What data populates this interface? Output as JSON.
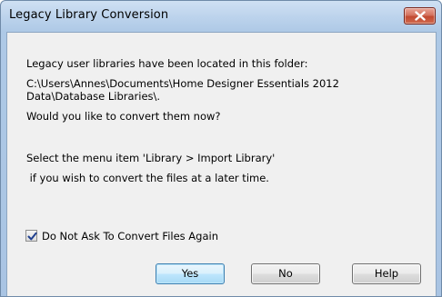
{
  "window": {
    "title": "Legacy Library Conversion"
  },
  "message": {
    "line1": "Legacy user libraries have been located in this folder:",
    "path_line1": "C:\\Users\\Annes\\Documents\\Home Designer Essentials 2012",
    "path_line2": "Data\\Database Libraries\\.",
    "question": "Would you like to convert them now?",
    "hint_line1": "Select the menu item 'Library > Import Library'",
    "hint_line2": " if you wish to convert the files at a later time."
  },
  "checkbox": {
    "label": "Do Not Ask To Convert Files Again",
    "checked": true
  },
  "buttons": {
    "yes": "Yes",
    "no": "No",
    "help": "Help"
  },
  "icons": {
    "close": "close-icon",
    "check": "checkmark-icon"
  },
  "colors": {
    "close_button": "#c24a31",
    "default_button_border": "#3c7fb1",
    "client_background": "#f0f0f0"
  }
}
